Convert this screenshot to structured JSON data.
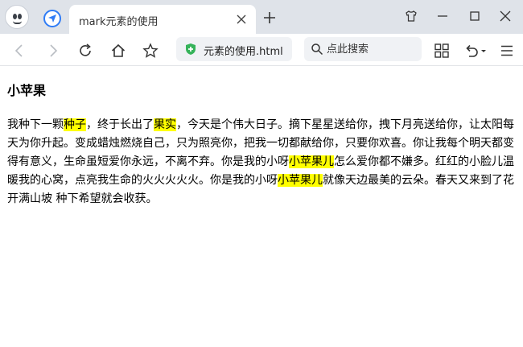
{
  "browser": {
    "tab_title": "mark元素的使用",
    "address": "元素的使用.html",
    "search_placeholder": "点此搜索"
  },
  "page": {
    "title": "小苹果",
    "paragraph": [
      {
        "text": "我种下一颗",
        "mark": false
      },
      {
        "text": "种子",
        "mark": true
      },
      {
        "text": "，终于长出了",
        "mark": false
      },
      {
        "text": "果实",
        "mark": true
      },
      {
        "text": "，今天是个伟大日子。摘下星星送给你，拽下月亮送给你，让太阳每天为你升起。变成蜡烛燃烧自己，只为照亮你，把我一切都献给你，只要你欢喜。你让我每个明天都变得有意义，生命虽短爱你永远，不离不弃。你是我的小呀",
        "mark": false
      },
      {
        "text": "小苹果儿",
        "mark": true
      },
      {
        "text": "怎么爱你都不嫌多。红红的小脸儿温暖我的心窝，点亮我生命的火火火火火。你是我的小呀",
        "mark": false
      },
      {
        "text": "小苹果儿",
        "mark": true
      },
      {
        "text": "就像天边最美的云朵。春天又来到了花开满山坡 种下希望就会收获。",
        "mark": false
      }
    ],
    "highlight_color": "#ffff00"
  }
}
